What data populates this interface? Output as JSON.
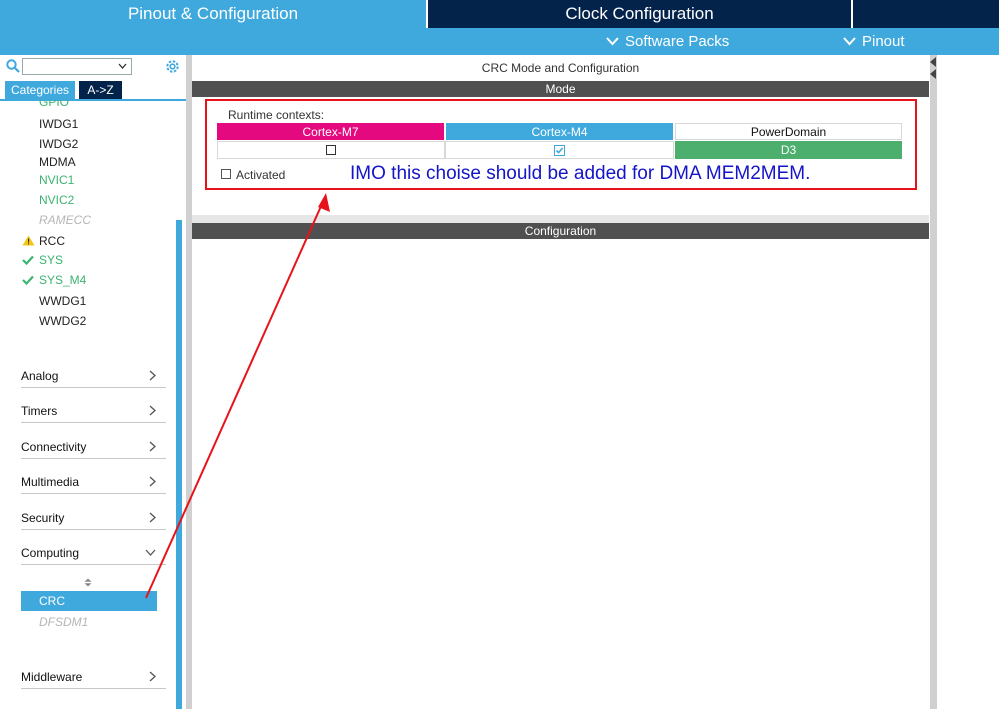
{
  "tabs": {
    "pinout": "Pinout & Configuration",
    "clock": "Clock Configuration"
  },
  "subbar": {
    "software_packs": "Software Packs",
    "pinout": "Pinout"
  },
  "left": {
    "category_tabs": [
      "Categories",
      "A->Z"
    ],
    "peripherals": [
      {
        "label": "GPIO",
        "style": "green"
      },
      {
        "label": "IWDG1",
        "style": "normal"
      },
      {
        "label": "IWDG2",
        "style": "normal"
      },
      {
        "label": "MDMA",
        "style": "normal"
      },
      {
        "label": "NVIC1",
        "style": "green"
      },
      {
        "label": "NVIC2",
        "style": "green"
      },
      {
        "label": "RAMECC",
        "style": "disabled"
      },
      {
        "label": "RCC",
        "style": "warning"
      },
      {
        "label": "SYS",
        "style": "ok"
      },
      {
        "label": "SYS_M4",
        "style": "ok"
      },
      {
        "label": "WWDG1",
        "style": "normal"
      },
      {
        "label": "WWDG2",
        "style": "normal"
      }
    ],
    "categories": [
      "Analog",
      "Timers",
      "Connectivity",
      "Multimedia",
      "Security",
      "Computing",
      "Middleware"
    ],
    "computing_items": [
      {
        "label": "CRC",
        "selected": true
      },
      {
        "label": "DFSDM1",
        "selected": false
      }
    ]
  },
  "main": {
    "title": "CRC Mode and Configuration",
    "mode_header": "Mode",
    "runtime_label": "Runtime contexts:",
    "contexts": [
      {
        "label": "Cortex-M7",
        "color": "#e5097f",
        "checked": false
      },
      {
        "label": "Cortex-M4",
        "color": "#3fa9dd",
        "checked": true
      },
      {
        "label": "PowerDomain",
        "value": "D3",
        "value_color": "#4caf6e"
      }
    ],
    "activated_label": "Activated",
    "configuration_header": "Configuration"
  },
  "annotation": {
    "text": "IMO this choise should be added for DMA MEM2MEM.",
    "color": "#1414c8"
  },
  "colors": {
    "accent": "#3fa9dd",
    "dark": "#03234b",
    "warning": "#f5c518",
    "ok": "#3cb371",
    "annotation_box": "#e8131a"
  }
}
